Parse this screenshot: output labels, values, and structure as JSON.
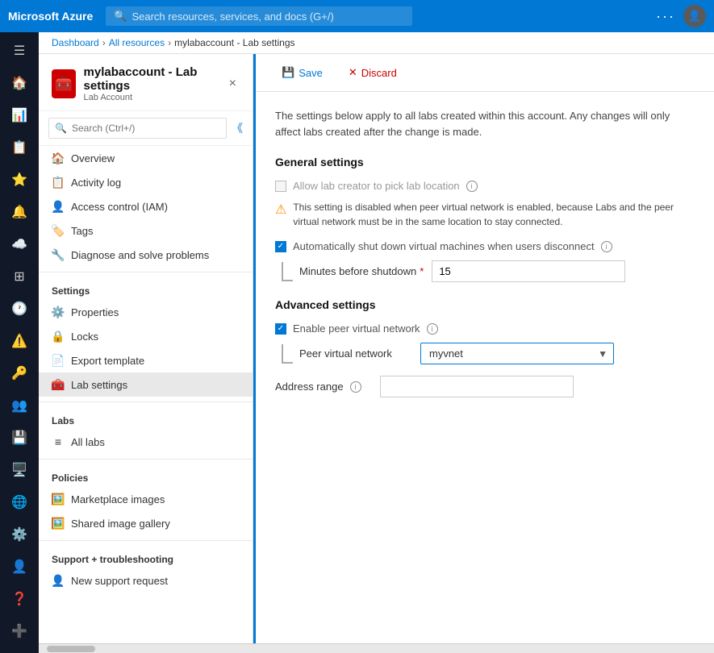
{
  "topNav": {
    "brand": "Microsoft Azure",
    "searchPlaceholder": "Search resources, services, and docs (G+/)"
  },
  "breadcrumb": {
    "items": [
      "Dashboard",
      "All resources",
      "mylabaccount - Lab settings"
    ]
  },
  "resource": {
    "title": "mylabaccount - Lab settings",
    "subtitle": "Lab Account",
    "closeLabel": "×"
  },
  "navSearch": {
    "placeholder": "Search (Ctrl+/)"
  },
  "navItems": {
    "general": [
      {
        "label": "Overview",
        "icon": "🏠"
      },
      {
        "label": "Activity log",
        "icon": "📋"
      },
      {
        "label": "Access control (IAM)",
        "icon": "👤"
      },
      {
        "label": "Tags",
        "icon": "🏷️"
      },
      {
        "label": "Diagnose and solve problems",
        "icon": "🔧"
      }
    ],
    "settingsLabel": "Settings",
    "settings": [
      {
        "label": "Properties",
        "icon": "⚙️"
      },
      {
        "label": "Locks",
        "icon": "🔒"
      },
      {
        "label": "Export template",
        "icon": "📄"
      },
      {
        "label": "Lab settings",
        "icon": "🧰",
        "active": true
      }
    ],
    "labsLabel": "Labs",
    "labs": [
      {
        "label": "All labs",
        "icon": "≡"
      }
    ],
    "policiesLabel": "Policies",
    "policies": [
      {
        "label": "Marketplace images",
        "icon": "🖼️"
      },
      {
        "label": "Shared image gallery",
        "icon": "🖼️"
      }
    ],
    "supportLabel": "Support + troubleshooting",
    "support": [
      {
        "label": "New support request",
        "icon": "👤"
      }
    ]
  },
  "toolbar": {
    "saveLabel": "Save",
    "discardLabel": "Discard"
  },
  "content": {
    "infoText": "The settings below apply to all labs created within this account. Any changes will only affect labs created after the change is made.",
    "generalSettings": {
      "sectionTitle": "General settings",
      "allowLabCreatorLabel": "Allow lab creator to pick lab location",
      "warningText": "This setting is disabled when peer virtual network is enabled, because Labs and the peer virtual network must be in the same location to stay connected.",
      "autoShutdownLabel": "Automatically shut down virtual machines when users disconnect",
      "minutesLabel": "Minutes before shutdown",
      "minutesRequired": "*",
      "minutesValue": "15"
    },
    "advancedSettings": {
      "sectionTitle": "Advanced settings",
      "enablePeerLabel": "Enable peer virtual network",
      "peerNetworkLabel": "Peer virtual network",
      "peerNetworkValue": "myvnet",
      "peerNetworkOptions": [
        "myvnet"
      ],
      "addressRangeLabel": "Address range",
      "addressRangeValue": ""
    }
  },
  "iconSidebar": {
    "items": [
      "≡",
      "🏠",
      "📊",
      "☰",
      "⭐",
      "🔔",
      "⚙️",
      "🔑",
      "👤",
      "🔲",
      "🔔",
      "📦",
      "➕"
    ]
  }
}
